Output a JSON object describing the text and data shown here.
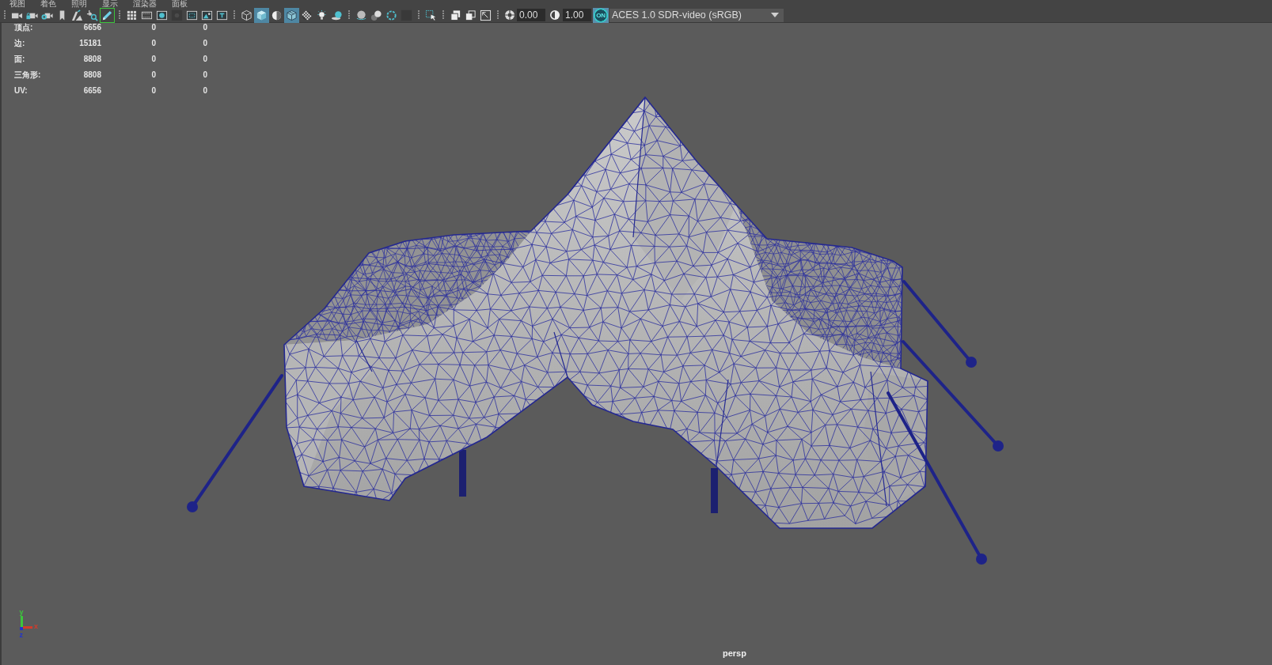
{
  "menu_bar": {
    "items": [
      "视图",
      "着色",
      "照明",
      "显示",
      "渲染器",
      "面板"
    ]
  },
  "toolbar": {
    "groups": [
      {
        "buttons": [
          {
            "on": false
          },
          {
            "on": false
          },
          {
            "on": false
          },
          {
            "on": false
          },
          {
            "on": false
          },
          {
            "on": false
          },
          {
            "on": true
          }
        ]
      },
      {
        "buttons": [
          {
            "on": false
          },
          {
            "on": false
          },
          {
            "on": false
          },
          {
            "on": false
          },
          {
            "on": false
          },
          {
            "on": false
          },
          {
            "on": false
          }
        ]
      },
      {
        "buttons": [
          {
            "on": false
          },
          {
            "on": true
          },
          {
            "on": false
          },
          {
            "on": true
          },
          {
            "on": false
          },
          {
            "on": false
          },
          {
            "on": false
          }
        ]
      },
      {
        "buttons": [
          {
            "on": false
          },
          {
            "on": false
          },
          {
            "on": false
          },
          {
            "on": false
          }
        ]
      },
      {
        "buttons": [
          {
            "on": false
          }
        ]
      },
      {
        "buttons": [
          {
            "on": false
          },
          {
            "on": false
          },
          {
            "on": false
          }
        ]
      }
    ],
    "exposure": "0.00",
    "gamma": "1.00",
    "color_management": {
      "label": "ON",
      "on": true
    },
    "view_transform": "ACES 1.0 SDR-video (sRGB)"
  },
  "heads_up_display": {
    "rows": [
      {
        "label": "顶点:",
        "values": [
          "6656",
          "0",
          "0"
        ]
      },
      {
        "label": "边:",
        "values": [
          "15181",
          "0",
          "0"
        ]
      },
      {
        "label": "面:",
        "values": [
          "8808",
          "0",
          "0"
        ]
      },
      {
        "label": "三角形:",
        "values": [
          "8808",
          "0",
          "0"
        ]
      },
      {
        "label": "UV:",
        "values": [
          "6656",
          "0",
          "0"
        ]
      }
    ]
  },
  "axis_gizmo": {
    "axes": [
      {
        "label": "x",
        "color": "#d23b2b"
      },
      {
        "label": "y",
        "color": "#3cc53c"
      },
      {
        "label": "z",
        "color": "#2233cc"
      }
    ]
  },
  "camera_label": "persp"
}
